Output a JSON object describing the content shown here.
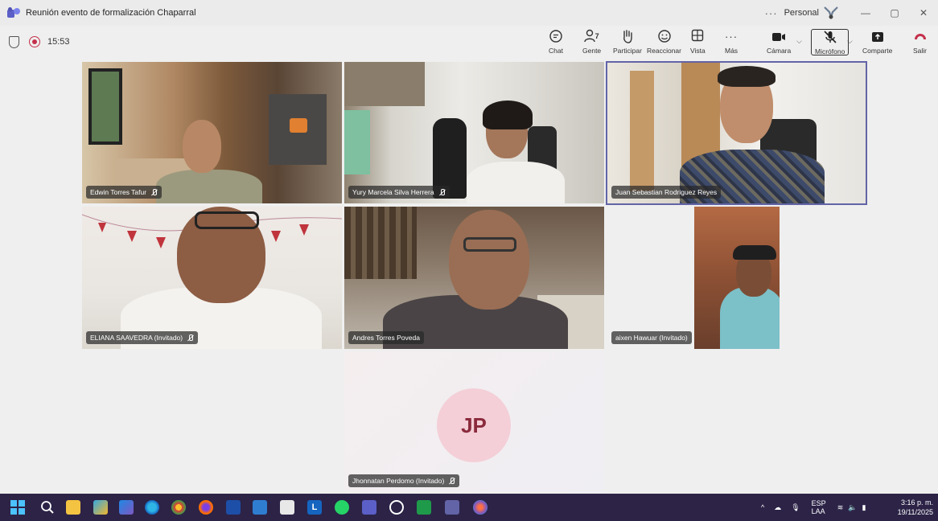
{
  "window": {
    "title": "Reunión evento de formalización Chaparral",
    "more": "···",
    "profile": "Personal",
    "minimize": "—",
    "restore": "▢",
    "close": "✕"
  },
  "meeting": {
    "timer": "15:53",
    "people_count": "7",
    "toolbar": {
      "chat": "Chat",
      "people": "Gente",
      "raise": "Participar",
      "react": "Reaccionar",
      "view": "Vista",
      "more": "Más",
      "camera": "Cámara",
      "mic": "Micrófono",
      "share": "Comparte",
      "leave": "Salir"
    }
  },
  "participants": [
    {
      "name": "Edwin Torres Tafur",
      "muted": true
    },
    {
      "name": "Yury Marcela Silva Herrera",
      "muted": true
    },
    {
      "name": "Juan Sebastian Rodriguez Reyes",
      "muted": false,
      "active_speaker": true
    },
    {
      "name": "ELIANA SAAVEDRA (Invitado)",
      "muted": true
    },
    {
      "name": "Andres Torres Poveda",
      "muted": false
    },
    {
      "name": "aixen Hawuar (Invitado)",
      "muted": false
    },
    {
      "name": "Jhonnatan Perdomo (Invitado)",
      "muted": true,
      "initials": "JP"
    }
  ],
  "taskbar": {
    "language_top": "ESP",
    "language_bottom": "LAA",
    "time": "3:16 p. m.",
    "date": "19/11/2025"
  },
  "colors": {
    "accent": "#5b5fc7",
    "record": "#c4314b",
    "taskbar": "#2c2347"
  }
}
